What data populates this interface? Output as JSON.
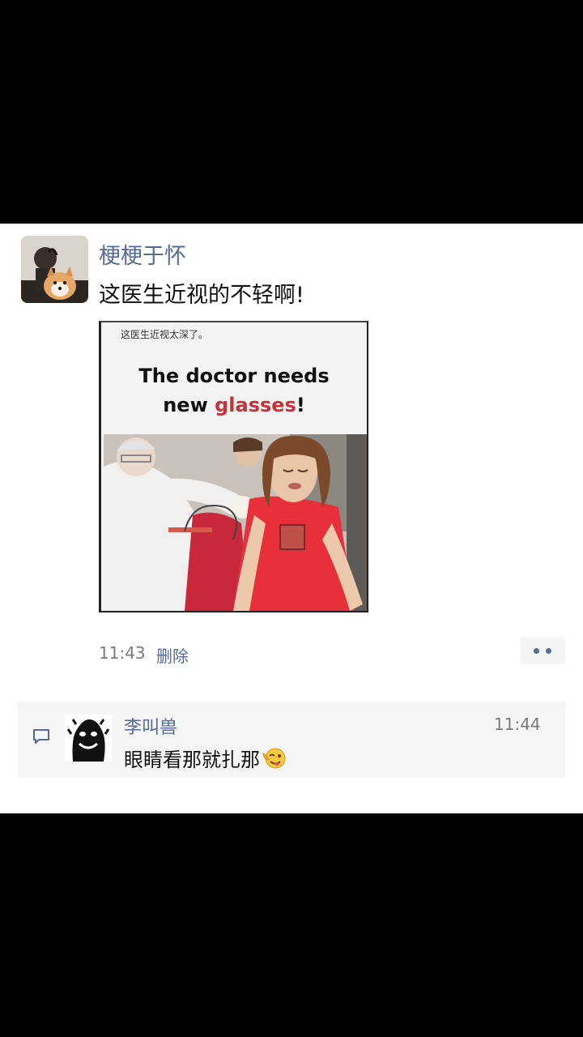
{
  "post": {
    "author": "梗梗于怀",
    "text": "这医生近视的不轻啊!",
    "media": {
      "small_caption": "这医生近视太深了。",
      "title_line1": "The doctor needs",
      "title_line2_prefix": "new ",
      "title_line2_highlight": "glasses",
      "title_line2_suffix": "!"
    },
    "time": "11:43",
    "delete_label": "删除"
  },
  "comment": {
    "author": "李叫兽",
    "time": "11:44",
    "text": "眼睛看那就扎那",
    "emoji_icon": "wink-tongue-emoji-icon"
  },
  "colors": {
    "link_blue": "#576b95",
    "highlight_red": "#c4333c",
    "comment_bg": "#f5f5f5"
  }
}
